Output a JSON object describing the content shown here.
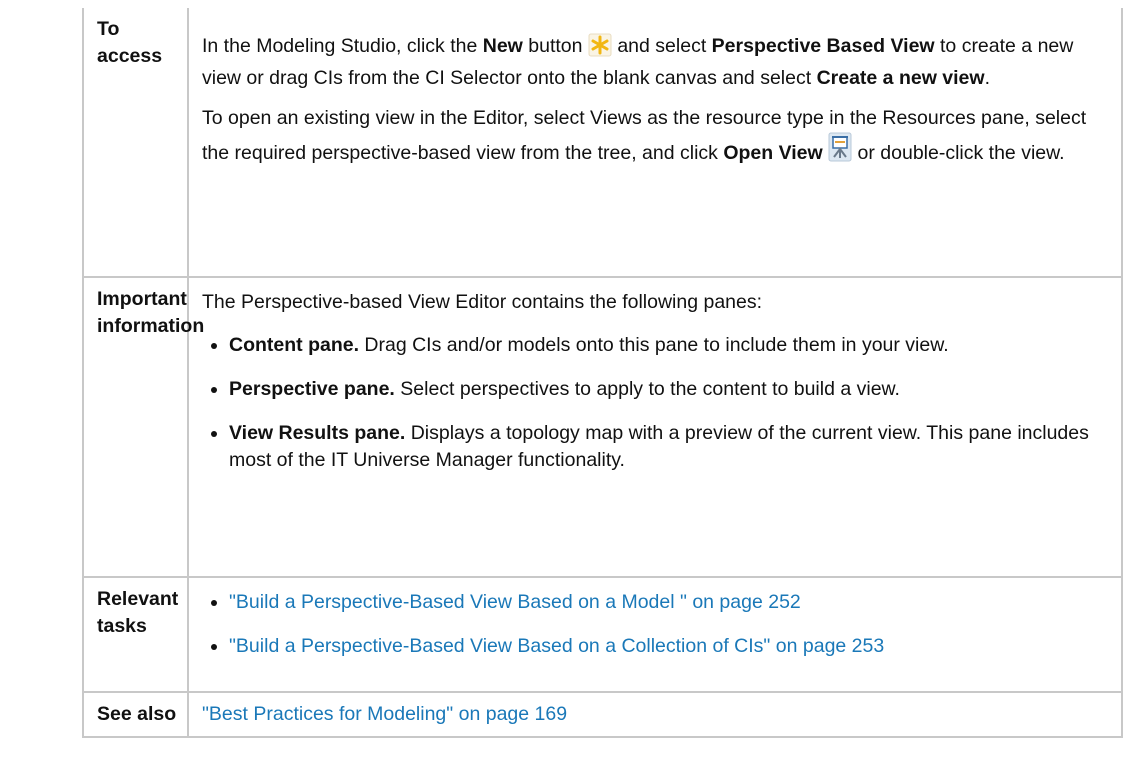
{
  "rows": {
    "access": {
      "label": "To access",
      "p1": {
        "t1": "In the Modeling Studio, click the ",
        "b1": "New",
        "t2": " button ",
        "icon": "new-asterisk-icon",
        "t3": " and select ",
        "b2": "Perspective Based View",
        "t4": " to create a new view or drag CIs from the CI Selector onto the blank canvas and select ",
        "b3": "Create a new view",
        "t5": "."
      },
      "p2": {
        "t1": "To open an existing view in the Editor, select Views as the resource type in the Resources pane, select the required perspective-based view from the tree, and click ",
        "b1": "Open View",
        "icon": "open-view-icon",
        "t2": " or double-click the view."
      }
    },
    "important": {
      "label": "Important information",
      "intro": "The Perspective-based View Editor contains the following panes:",
      "bullets": [
        {
          "bold": "Content pane.",
          "text": " Drag CIs and/or models onto this pane to include them in your view."
        },
        {
          "bold": "Perspective pane.",
          "text": " Select perspectives to apply to the content to build a view."
        },
        {
          "bold": "View Results pane.",
          "text": " Displays a topology map with a preview of the current view. This pane includes most of the IT Universe Manager functionality."
        }
      ]
    },
    "tasks": {
      "label": "Relevant tasks",
      "links": [
        "\"Build a Perspective-Based View Based on a Model \" on page 252",
        "\"Build a Perspective-Based View Based on a Collection of CIs\" on page 253"
      ]
    },
    "see_also": {
      "label": "See also",
      "link": "\"Best Practices for Modeling\" on page 169"
    }
  },
  "colors": {
    "link": "#1a78b8",
    "border": "#c8c8c8",
    "text": "#111111"
  }
}
